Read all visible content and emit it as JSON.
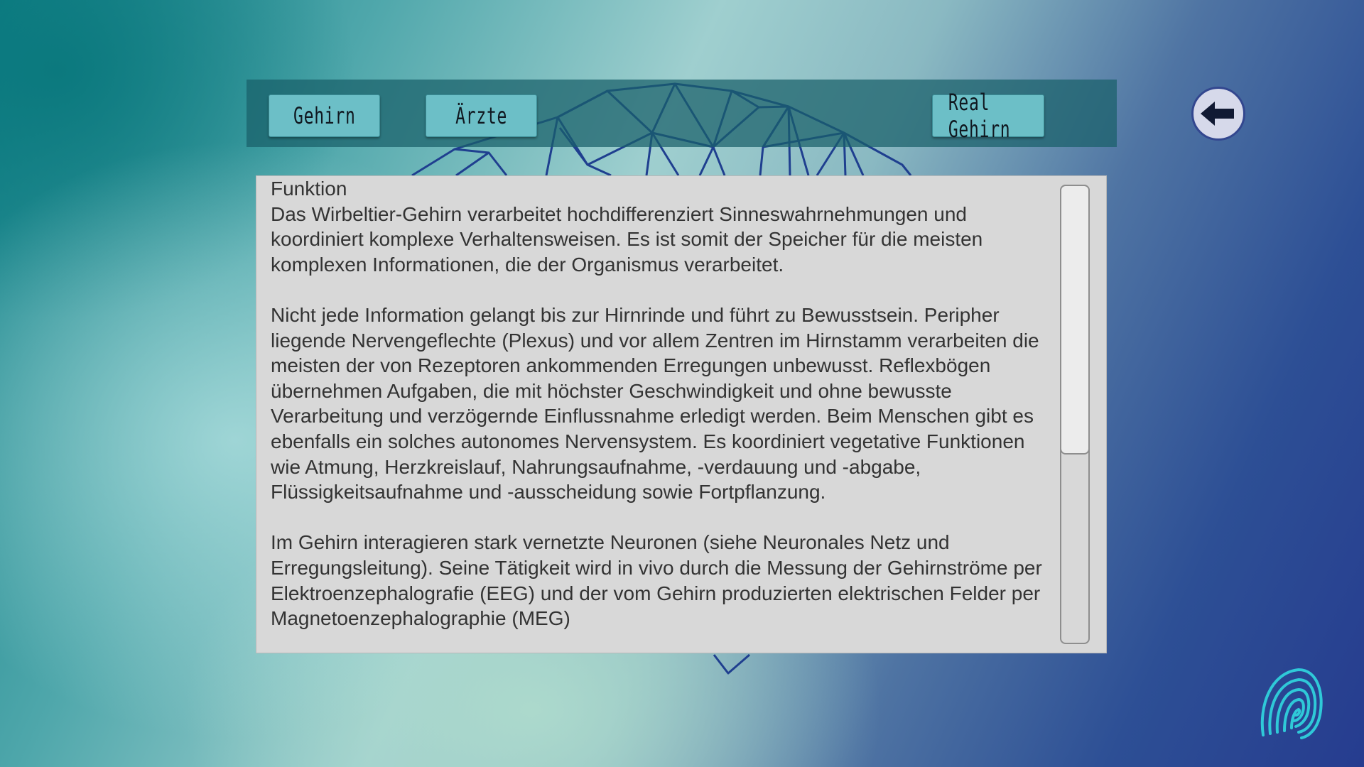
{
  "nav": {
    "gehirn_label": "Gehirn",
    "aerzte_label": "Ärzte",
    "real_gehirn_label": "Real Gehirn"
  },
  "content": {
    "title": "Funktion",
    "paragraph_1": "Das Wirbeltier-Gehirn verarbeitet hochdifferenziert Sinneswahrnehmungen und koordiniert komplexe Verhaltensweisen. Es ist somit der Speicher für die meisten komplexen Informationen, die der Organismus verarbeitet.",
    "paragraph_2": "Nicht jede Information gelangt bis zur Hirnrinde und führt zu Bewusstsein. Peripher liegende Nervengeflechte (Plexus) und vor allem Zentren im Hirnstamm verarbeiten die meisten der von Rezeptoren ankommenden Erregungen unbewusst. Reflexbögen übernehmen Aufgaben, die mit höchster Geschwindigkeit und ohne bewusste Verarbeitung und verzögernde Einflussnahme erledigt werden. Beim Menschen gibt es ebenfalls ein solches autonomes Nervensystem. Es koordiniert vegetative Funktionen wie Atmung, Herzkreislauf, Nahrungsaufnahme, -verdauung und -abgabe, Flüssigkeitsaufnahme und -ausscheidung sowie Fortpflanzung.",
    "paragraph_3": "Im Gehirn interagieren stark vernetzte Neuronen (siehe Neuronales Netz und Erregungsleitung). Seine Tätigkeit wird in vivo durch die Messung der Gehirnströme per Elektroenzephalografie (EEG) und der vom Gehirn produzierten elektrischen Felder per Magnetoenzephalographie (MEG)"
  },
  "icons": {
    "back": "arrow-left-icon",
    "fingerprint": "fingerprint-icon"
  },
  "colors": {
    "top_bar": "#195f69",
    "button_fill": "#6cbfc7",
    "panel_fill": "#d8d8d8",
    "mesh_lines": "#1f3f8f",
    "fingerprint": "#2fc9d8"
  }
}
